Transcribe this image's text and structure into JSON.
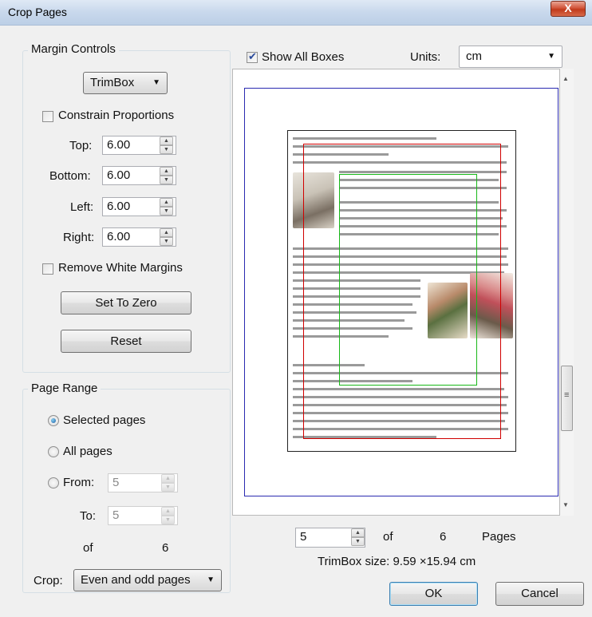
{
  "window": {
    "title": "Crop Pages",
    "close_glyph": "X"
  },
  "margin_controls": {
    "legend": "Margin Controls",
    "box_type": "TrimBox",
    "constrain_proportions": {
      "label": "Constrain Proportions",
      "checked": false
    },
    "fields": {
      "top": {
        "label": "Top:",
        "value": "6.00"
      },
      "bottom": {
        "label": "Bottom:",
        "value": "6.00"
      },
      "left": {
        "label": "Left:",
        "value": "6.00"
      },
      "right": {
        "label": "Right:",
        "value": "6.00"
      }
    },
    "remove_white_margins": {
      "label": "Remove White Margins",
      "checked": false
    },
    "set_to_zero": "Set To Zero",
    "reset": "Reset"
  },
  "page_range": {
    "legend": "Page Range",
    "selected_pages": "Selected pages",
    "all_pages": "All pages",
    "from_label": "From:",
    "from_value": "5",
    "to_label": "To:",
    "to_value": "5",
    "of_label": "of",
    "of_total": "6",
    "crop_label": "Crop:",
    "crop_value": "Even and odd pages",
    "selected_option": "Selected pages"
  },
  "preview": {
    "show_all_boxes": {
      "label": "Show All Boxes",
      "checked": true
    },
    "units_label": "Units:",
    "units_value": "cm"
  },
  "navigation": {
    "page_value": "5",
    "of_label": "of",
    "total_pages": "6",
    "pages_label": "Pages",
    "trimbox_size": "TrimBox size: 9.59 ×15.94 cm"
  },
  "buttons": {
    "ok": "OK",
    "cancel": "Cancel"
  },
  "colors": {
    "media_box": "#2a2ab0",
    "trim_box": "#d00000",
    "art_box": "#18b818"
  },
  "icons": {
    "spin_up": "▲",
    "spin_down": "▼",
    "dropdown": "▼",
    "scroll_up": "▲",
    "scroll_down": "▼",
    "grip": "≡"
  }
}
